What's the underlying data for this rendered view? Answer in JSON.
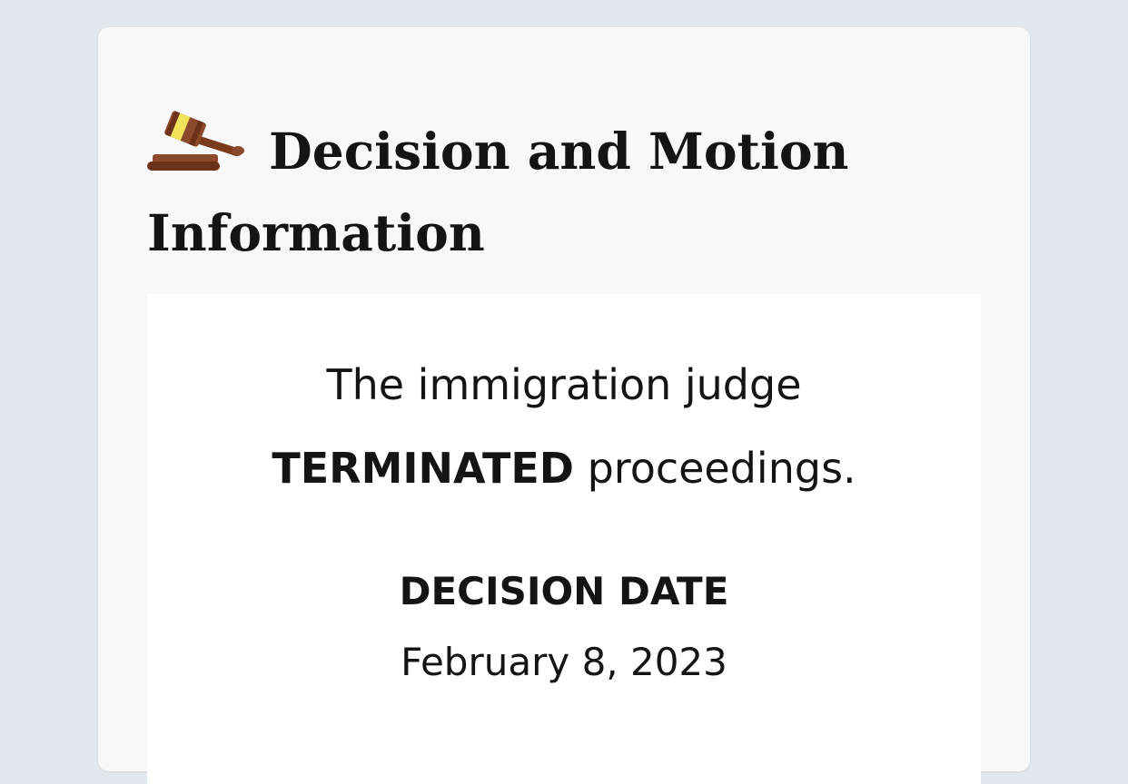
{
  "section": {
    "icon": "gavel-icon",
    "title": "Decision and Motion Information"
  },
  "decision": {
    "text_before": "The immigration judge",
    "status": "TERMINATED",
    "text_after": "proceedings.",
    "date_label": "DECISION DATE",
    "date_value": "February 8, 2023"
  },
  "colors": {
    "page_background": "#e3e8ef",
    "card_background": "#f8f8f8",
    "panel_background": "#ffffff",
    "text": "#141414"
  }
}
